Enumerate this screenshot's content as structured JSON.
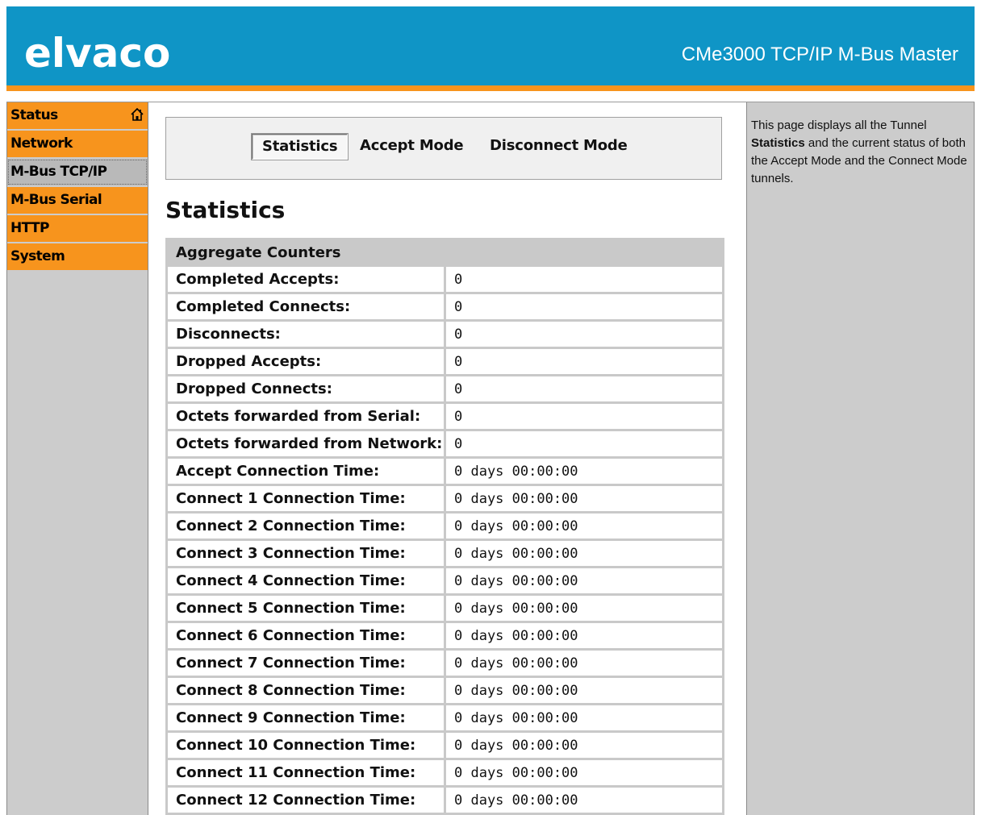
{
  "header": {
    "logo": "elvaco",
    "product": "CMe3000 TCP/IP M-Bus Master",
    "brand_blue": "#0f95c6",
    "brand_orange": "#f7941d"
  },
  "nav": {
    "items": [
      {
        "label": "Status",
        "icon": "home-icon"
      },
      {
        "label": "Network"
      },
      {
        "label": "M-Bus TCP/IP",
        "active": true
      },
      {
        "label": "M-Bus Serial"
      },
      {
        "label": "HTTP"
      },
      {
        "label": "System"
      }
    ]
  },
  "tabs": {
    "statistics": "Statistics",
    "accept": "Accept Mode",
    "disconnect": "Disconnect Mode",
    "selected": "Statistics"
  },
  "main": {
    "title": "Statistics",
    "table_header": "Aggregate Counters",
    "rows": [
      {
        "label": "Completed Accepts:",
        "value": "0"
      },
      {
        "label": "Completed Connects:",
        "value": "0"
      },
      {
        "label": "Disconnects:",
        "value": "0"
      },
      {
        "label": "Dropped Accepts:",
        "value": "0"
      },
      {
        "label": "Dropped Connects:",
        "value": "0"
      },
      {
        "label": "Octets forwarded from Serial:",
        "value": "0"
      },
      {
        "label": "Octets forwarded from Network:",
        "value": "0"
      },
      {
        "label": "Accept Connection Time:",
        "value": "0 days 00:00:00"
      },
      {
        "label": "Connect 1 Connection Time:",
        "value": "0 days 00:00:00"
      },
      {
        "label": "Connect 2 Connection Time:",
        "value": "0 days 00:00:00"
      },
      {
        "label": "Connect 3 Connection Time:",
        "value": "0 days 00:00:00"
      },
      {
        "label": "Connect 4 Connection Time:",
        "value": "0 days 00:00:00"
      },
      {
        "label": "Connect 5 Connection Time:",
        "value": "0 days 00:00:00"
      },
      {
        "label": "Connect 6 Connection Time:",
        "value": "0 days 00:00:00"
      },
      {
        "label": "Connect 7 Connection Time:",
        "value": "0 days 00:00:00"
      },
      {
        "label": "Connect 8 Connection Time:",
        "value": "0 days 00:00:00"
      },
      {
        "label": "Connect 9 Connection Time:",
        "value": "0 days 00:00:00"
      },
      {
        "label": "Connect 10 Connection Time:",
        "value": "0 days 00:00:00"
      },
      {
        "label": "Connect 11 Connection Time:",
        "value": "0 days 00:00:00"
      },
      {
        "label": "Connect 12 Connection Time:",
        "value": "0 days 00:00:00"
      }
    ]
  },
  "help": {
    "pre": "This page displays all the Tunnel",
    "bold": "Statistics",
    "post": "and the current status of both the Accept Mode and the Connect Mode tunnels."
  }
}
